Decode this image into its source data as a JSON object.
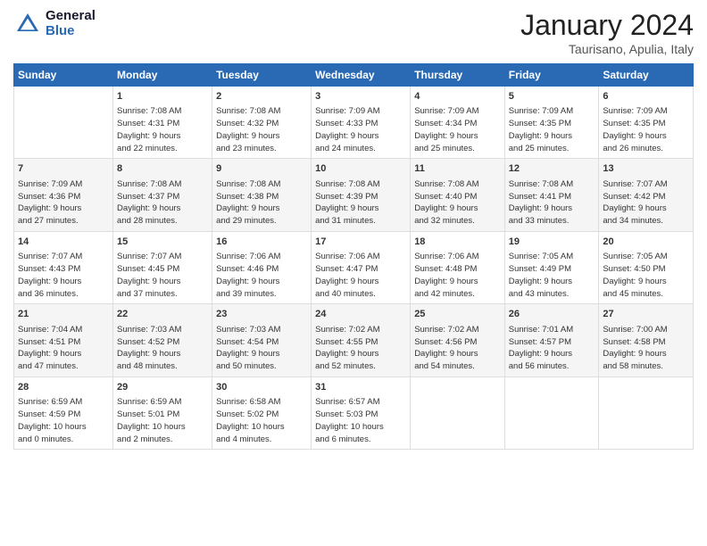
{
  "header": {
    "logo_line1": "General",
    "logo_line2": "Blue",
    "month": "January 2024",
    "location": "Taurisano, Apulia, Italy"
  },
  "days_of_week": [
    "Sunday",
    "Monday",
    "Tuesday",
    "Wednesday",
    "Thursday",
    "Friday",
    "Saturday"
  ],
  "weeks": [
    [
      {
        "day": "",
        "info": ""
      },
      {
        "day": "1",
        "info": "Sunrise: 7:08 AM\nSunset: 4:31 PM\nDaylight: 9 hours\nand 22 minutes."
      },
      {
        "day": "2",
        "info": "Sunrise: 7:08 AM\nSunset: 4:32 PM\nDaylight: 9 hours\nand 23 minutes."
      },
      {
        "day": "3",
        "info": "Sunrise: 7:09 AM\nSunset: 4:33 PM\nDaylight: 9 hours\nand 24 minutes."
      },
      {
        "day": "4",
        "info": "Sunrise: 7:09 AM\nSunset: 4:34 PM\nDaylight: 9 hours\nand 25 minutes."
      },
      {
        "day": "5",
        "info": "Sunrise: 7:09 AM\nSunset: 4:35 PM\nDaylight: 9 hours\nand 25 minutes."
      },
      {
        "day": "6",
        "info": "Sunrise: 7:09 AM\nSunset: 4:35 PM\nDaylight: 9 hours\nand 26 minutes."
      }
    ],
    [
      {
        "day": "7",
        "info": "Sunrise: 7:09 AM\nSunset: 4:36 PM\nDaylight: 9 hours\nand 27 minutes."
      },
      {
        "day": "8",
        "info": "Sunrise: 7:08 AM\nSunset: 4:37 PM\nDaylight: 9 hours\nand 28 minutes."
      },
      {
        "day": "9",
        "info": "Sunrise: 7:08 AM\nSunset: 4:38 PM\nDaylight: 9 hours\nand 29 minutes."
      },
      {
        "day": "10",
        "info": "Sunrise: 7:08 AM\nSunset: 4:39 PM\nDaylight: 9 hours\nand 31 minutes."
      },
      {
        "day": "11",
        "info": "Sunrise: 7:08 AM\nSunset: 4:40 PM\nDaylight: 9 hours\nand 32 minutes."
      },
      {
        "day": "12",
        "info": "Sunrise: 7:08 AM\nSunset: 4:41 PM\nDaylight: 9 hours\nand 33 minutes."
      },
      {
        "day": "13",
        "info": "Sunrise: 7:07 AM\nSunset: 4:42 PM\nDaylight: 9 hours\nand 34 minutes."
      }
    ],
    [
      {
        "day": "14",
        "info": "Sunrise: 7:07 AM\nSunset: 4:43 PM\nDaylight: 9 hours\nand 36 minutes."
      },
      {
        "day": "15",
        "info": "Sunrise: 7:07 AM\nSunset: 4:45 PM\nDaylight: 9 hours\nand 37 minutes."
      },
      {
        "day": "16",
        "info": "Sunrise: 7:06 AM\nSunset: 4:46 PM\nDaylight: 9 hours\nand 39 minutes."
      },
      {
        "day": "17",
        "info": "Sunrise: 7:06 AM\nSunset: 4:47 PM\nDaylight: 9 hours\nand 40 minutes."
      },
      {
        "day": "18",
        "info": "Sunrise: 7:06 AM\nSunset: 4:48 PM\nDaylight: 9 hours\nand 42 minutes."
      },
      {
        "day": "19",
        "info": "Sunrise: 7:05 AM\nSunset: 4:49 PM\nDaylight: 9 hours\nand 43 minutes."
      },
      {
        "day": "20",
        "info": "Sunrise: 7:05 AM\nSunset: 4:50 PM\nDaylight: 9 hours\nand 45 minutes."
      }
    ],
    [
      {
        "day": "21",
        "info": "Sunrise: 7:04 AM\nSunset: 4:51 PM\nDaylight: 9 hours\nand 47 minutes."
      },
      {
        "day": "22",
        "info": "Sunrise: 7:03 AM\nSunset: 4:52 PM\nDaylight: 9 hours\nand 48 minutes."
      },
      {
        "day": "23",
        "info": "Sunrise: 7:03 AM\nSunset: 4:54 PM\nDaylight: 9 hours\nand 50 minutes."
      },
      {
        "day": "24",
        "info": "Sunrise: 7:02 AM\nSunset: 4:55 PM\nDaylight: 9 hours\nand 52 minutes."
      },
      {
        "day": "25",
        "info": "Sunrise: 7:02 AM\nSunset: 4:56 PM\nDaylight: 9 hours\nand 54 minutes."
      },
      {
        "day": "26",
        "info": "Sunrise: 7:01 AM\nSunset: 4:57 PM\nDaylight: 9 hours\nand 56 minutes."
      },
      {
        "day": "27",
        "info": "Sunrise: 7:00 AM\nSunset: 4:58 PM\nDaylight: 9 hours\nand 58 minutes."
      }
    ],
    [
      {
        "day": "28",
        "info": "Sunrise: 6:59 AM\nSunset: 4:59 PM\nDaylight: 10 hours\nand 0 minutes."
      },
      {
        "day": "29",
        "info": "Sunrise: 6:59 AM\nSunset: 5:01 PM\nDaylight: 10 hours\nand 2 minutes."
      },
      {
        "day": "30",
        "info": "Sunrise: 6:58 AM\nSunset: 5:02 PM\nDaylight: 10 hours\nand 4 minutes."
      },
      {
        "day": "31",
        "info": "Sunrise: 6:57 AM\nSunset: 5:03 PM\nDaylight: 10 hours\nand 6 minutes."
      },
      {
        "day": "",
        "info": ""
      },
      {
        "day": "",
        "info": ""
      },
      {
        "day": "",
        "info": ""
      }
    ]
  ]
}
